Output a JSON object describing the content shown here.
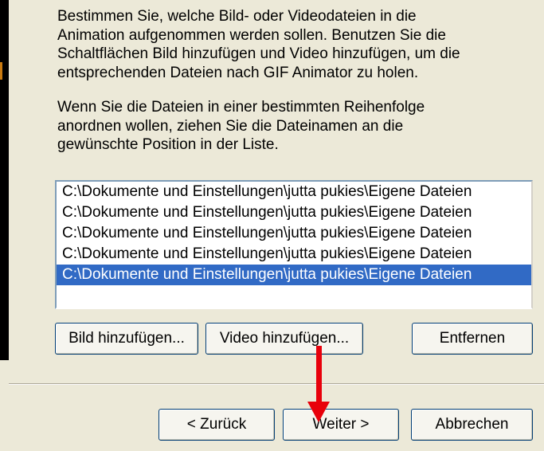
{
  "instructions": {
    "paragraph_1": "Bestimmen Sie, welche Bild- oder Videodateien in die\nAnimation aufgenommen werden sollen. Benutzen Sie die\nSchaltflächen Bild hinzufügen und Video hinzufügen, um die\nentsprechenden Dateien nach GIF Animator zu holen.",
    "paragraph_2": "Wenn Sie die Dateien in einer bestimmten Reihenfolge\nanordnen wollen, ziehen Sie die Dateinamen an die\ngewünschte Position in der Liste."
  },
  "file_list": {
    "items": [
      "C:\\Dokumente und Einstellungen\\jutta pukies\\Eigene Dateien",
      "C:\\Dokumente und Einstellungen\\jutta pukies\\Eigene Dateien",
      "C:\\Dokumente und Einstellungen\\jutta pukies\\Eigene Dateien",
      "C:\\Dokumente und Einstellungen\\jutta pukies\\Eigene Dateien",
      "C:\\Dokumente und Einstellungen\\jutta pukies\\Eigene Dateien"
    ],
    "selected_index": 4
  },
  "buttons": {
    "add_image": "Bild hinzufügen...",
    "add_video": "Video hinzufügen...",
    "remove": "Entfernen",
    "back": "< Zurück",
    "next": "Weiter >",
    "cancel": "Abbrechen"
  },
  "annotation": {
    "arrow_icon": "red-down-arrow-icon",
    "arrow_color": "#e8000b"
  },
  "colors": {
    "dialog_background": "#ece9d8",
    "selection": "#316ac5",
    "list_border": "#7f9db9"
  }
}
